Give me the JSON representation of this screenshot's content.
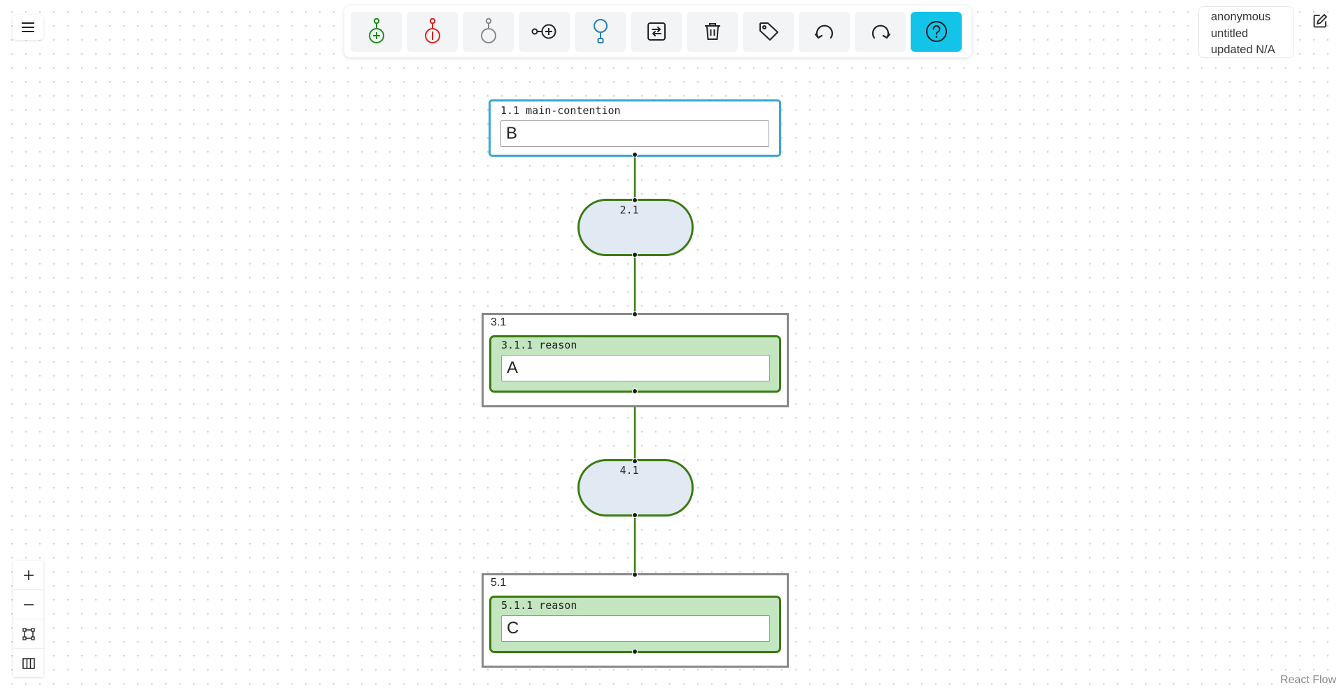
{
  "toolbar": {
    "items": [
      {
        "name": "add-support-button",
        "icon": "add-support-icon",
        "color": "#1e8a1e"
      },
      {
        "name": "add-oppose-button",
        "icon": "add-oppose-icon",
        "color": "#e02020"
      },
      {
        "name": "add-neutral-button",
        "icon": "add-neutral-icon",
        "color": "#888888"
      },
      {
        "name": "add-child-button",
        "icon": "connect-add-icon",
        "color": "#222222"
      },
      {
        "name": "add-claim-button",
        "icon": "claim-node-icon",
        "color": "#2a7fb0"
      },
      {
        "name": "toggle-button",
        "icon": "toggle-icon",
        "color": "#222222"
      },
      {
        "name": "delete-button",
        "icon": "trash-icon",
        "color": "#222222"
      },
      {
        "name": "tag-button",
        "icon": "tag-icon",
        "color": "#222222"
      },
      {
        "name": "undo-button",
        "icon": "undo-icon",
        "color": "#222222"
      },
      {
        "name": "redo-button",
        "icon": "redo-icon",
        "color": "#222222"
      },
      {
        "name": "help-button",
        "icon": "help-icon",
        "color": "#14c4e8"
      }
    ]
  },
  "info": {
    "user": "anonymous",
    "title": "untitled",
    "updated": "updated N/A"
  },
  "nodes": {
    "claim": {
      "label": "1.1 main-contention",
      "value": "B",
      "color": "#3aa6cf"
    },
    "connector1": {
      "label": "2.1"
    },
    "group1": {
      "label": "3.1",
      "reason": {
        "label": "3.1.1 reason",
        "value": "A"
      }
    },
    "connector2": {
      "label": "4.1"
    },
    "group2": {
      "label": "5.1",
      "reason": {
        "label": "5.1.1 reason",
        "value": "C"
      }
    }
  },
  "colors": {
    "edge": "#3a7a10",
    "reason_fill": "#c3e6c0",
    "pill_fill": "#e1eaf3",
    "help": "#14c4e8"
  },
  "controls": {
    "items": [
      "zoom-in",
      "zoom-out",
      "fit-view",
      "minimap-toggle"
    ]
  },
  "attribution": "React Flow"
}
